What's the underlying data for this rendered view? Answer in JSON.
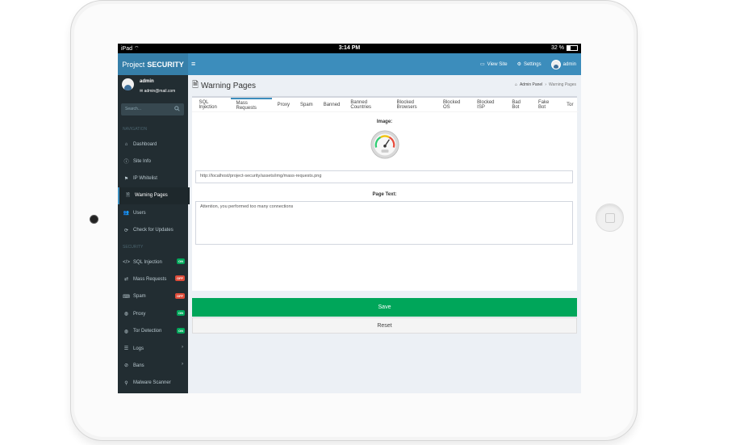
{
  "status_bar": {
    "device": "iPad",
    "time": "3:14 PM",
    "battery": "32 %",
    "battery_level": 0.32
  },
  "header": {
    "brand_light": "Project",
    "brand_bold": "SECURITY",
    "view_site": "View Site",
    "settings": "Settings",
    "user": "admin"
  },
  "sidebar": {
    "user_name": "admin",
    "user_email": "admin@mail.com",
    "search_placeholder": "Search...",
    "section_navigation": "NAVIGATION",
    "section_security": "SECURITY",
    "nav_items": [
      {
        "label": "Dashboard",
        "icon": "home-icon"
      },
      {
        "label": "Site Info",
        "icon": "info-icon"
      },
      {
        "label": "IP Whitelist",
        "icon": "flag-icon"
      },
      {
        "label": "Warning Pages",
        "icon": "file-icon",
        "active": true
      },
      {
        "label": "Users",
        "icon": "users-icon"
      },
      {
        "label": "Check for Updates",
        "icon": "refresh-icon"
      }
    ],
    "security_items": [
      {
        "label": "SQL Injection",
        "icon": "code-icon",
        "badge": "ON",
        "badge_color": "#00a65a"
      },
      {
        "label": "Mass Requests",
        "icon": "retweet-icon",
        "badge": "OFF",
        "badge_color": "#dd4b39"
      },
      {
        "label": "Spam",
        "icon": "keyboard-icon",
        "badge": "OFF",
        "badge_color": "#dd4b39"
      },
      {
        "label": "Proxy",
        "icon": "globe-icon",
        "badge": "ON",
        "badge_color": "#00a65a"
      },
      {
        "label": "Tor Detection",
        "icon": "globe-icon",
        "badge": "ON",
        "badge_color": "#00a65a"
      },
      {
        "label": "Logs",
        "icon": "list-icon",
        "chevron": "›"
      },
      {
        "label": "Bans",
        "icon": "ban-icon",
        "chevron": "›"
      },
      {
        "label": "Malware Scanner",
        "icon": "search-icon"
      }
    ]
  },
  "main": {
    "page_title": "Warning Pages",
    "breadcrumb": {
      "home": "Admin Panel",
      "current": "Warning Pages"
    },
    "tabs": [
      "SQL Injection",
      "Mass Requests",
      "Proxy",
      "Spam",
      "Banned",
      "Banned Countries",
      "Blocked Browsers",
      "Blocked OS",
      "Blocked ISP",
      "Bad Bot",
      "Fake Bot",
      "Tor"
    ],
    "active_tab": 1,
    "image_label": "Image:",
    "image_path": "http://localhost/project-security/assets/img/mass-requests.png",
    "page_text_label": "Page Text:",
    "page_text": "Attention, you performed too many connections",
    "save_label": "Save",
    "reset_label": "Reset"
  },
  "colors": {
    "header": "#3c8dbc",
    "brand_bg": "#367fa9",
    "sidebar": "#222d32",
    "save": "#00a65a"
  }
}
